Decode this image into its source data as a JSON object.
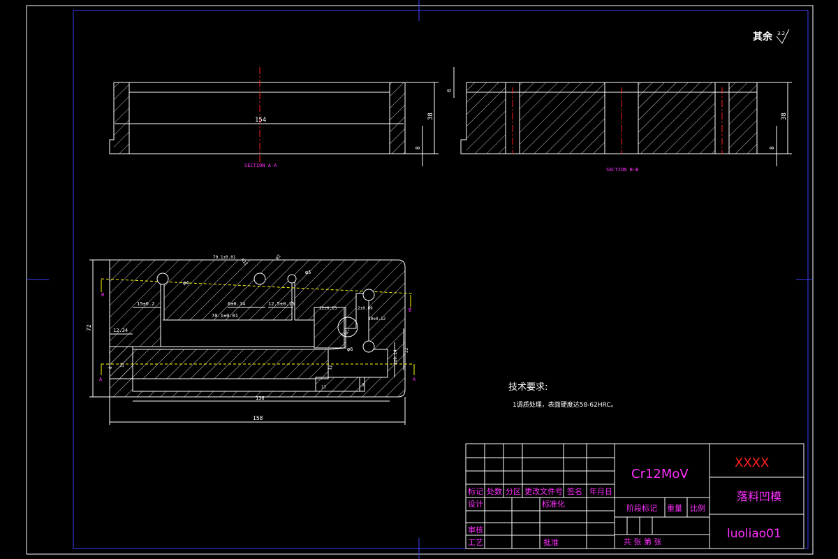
{
  "roughness_note": {
    "label": "其余",
    "value": "3.2"
  },
  "section_a": {
    "title": "SECTION A-A",
    "dim_length": "154",
    "dim_height": "38",
    "dim_step": "8"
  },
  "section_b": {
    "title": "SECTION B-B",
    "dim_top": "6",
    "dim_height": "38",
    "dim_step": "8"
  },
  "plan_view": {
    "dims": {
      "d_70_1_top": "70.1±0.01",
      "d_r12": "R12",
      "d_r2": "R2",
      "d_phi4": "φ4",
      "d_phi5": "φ5",
      "d_15": "15±0.2",
      "d_6": "6±0.14",
      "d_12_5": "12.5±0.15",
      "d_70_1_mid": "70.1±0.01",
      "d_12_right": "12±0.15",
      "d_2_right": "2±0.09",
      "d_10": "10±0.12",
      "d_116": "116°",
      "d_phi6": "φ6",
      "d_72": "72",
      "d_12_34": "12.34",
      "d_8": "8",
      "d_12_left": "12",
      "d_1_right": "1±0.14",
      "d_17": "17",
      "d_11": "11",
      "d_136": "136",
      "d_158": "158",
      "d_3": "3",
      "d_22": "22"
    },
    "section_marks": {
      "a": "A",
      "b": "B"
    }
  },
  "tech_req": {
    "title": "技术要求:",
    "line1": "1调质处理，表面硬度达58-62HRC。"
  },
  "title_block": {
    "material": "Cr12MoV",
    "company": "XXXX",
    "part_name": "落料凹模",
    "drawing_no": "luoliao01",
    "headers": [
      "标记",
      "处数",
      "分区",
      "更改文件号",
      "签名",
      "年月日"
    ],
    "design": "设计",
    "standardization": "标准化",
    "review": "审核",
    "process": "工艺",
    "approve": "批准",
    "stage_mark": "阶段标记",
    "weight": "重量",
    "scale": "比例",
    "sheets": "共  张 第  张"
  }
}
